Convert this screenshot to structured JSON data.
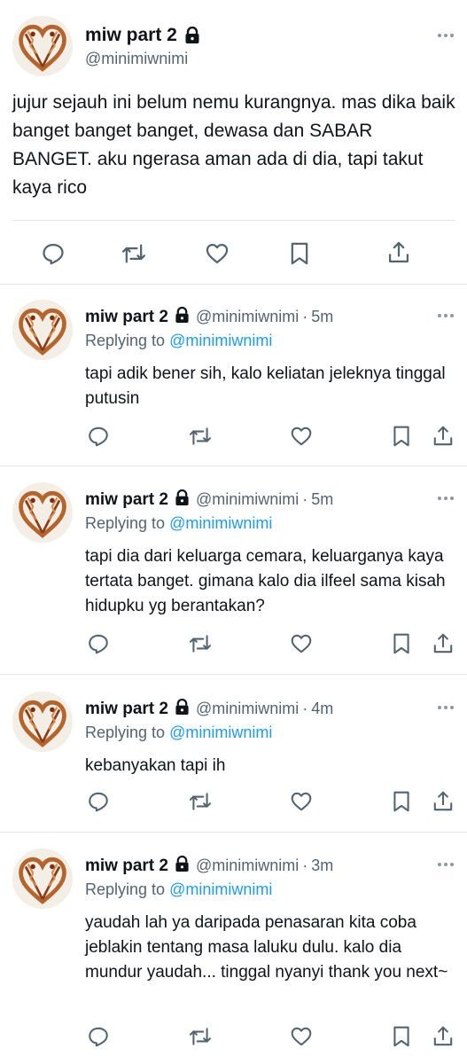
{
  "main_tweet": {
    "name": "miw part 2",
    "handle": "@minimiwnimi",
    "text": "jujur sejauh ini belum nemu kurangnya. mas dika baik banget banget banget, dewasa dan SABAR BANGET. aku ngerasa aman ada di dia, tapi takut kaya rico",
    "actions": [
      "reply-icon",
      "retweet-icon",
      "like-icon",
      "bookmark-icon",
      "share-icon"
    ]
  },
  "replies": [
    {
      "name": "miw part 2",
      "handle": "@minimiwnimi",
      "separator": "·",
      "time": "5m",
      "replying_prefix": "Replying to",
      "replying_to": "@minimiwnimi",
      "text": "tapi adik bener sih, kalo keliatan jeleknya tinggal putusin"
    },
    {
      "name": "miw part 2",
      "handle": "@minimiwnimi",
      "separator": "·",
      "time": "5m",
      "replying_prefix": "Replying to",
      "replying_to": "@minimiwnimi",
      "text": "tapi dia dari keluarga cemara, keluarganya kaya tertata banget. gimana kalo dia ilfeel sama kisah hidupku yg berantakan?"
    },
    {
      "name": "miw part 2",
      "handle": "@minimiwnimi",
      "separator": "·",
      "time": "4m",
      "replying_prefix": "Replying to",
      "replying_to": "@minimiwnimi",
      "text": "kebanyakan tapi ih"
    },
    {
      "name": "miw part 2",
      "handle": "@minimiwnimi",
      "separator": "·",
      "time": "3m",
      "replying_prefix": "Replying to",
      "replying_to": "@minimiwnimi",
      "text": "yaudah lah ya daripada penasaran kita coba jeblakin tentang masa laluku dulu. kalo dia mundur yaudah... tinggal nyanyi thank you next~"
    }
  ],
  "colors": {
    "text": "#0f1419",
    "secondary": "#536471",
    "mention": "#1d9bf0",
    "divider": "#e1e5e8"
  }
}
